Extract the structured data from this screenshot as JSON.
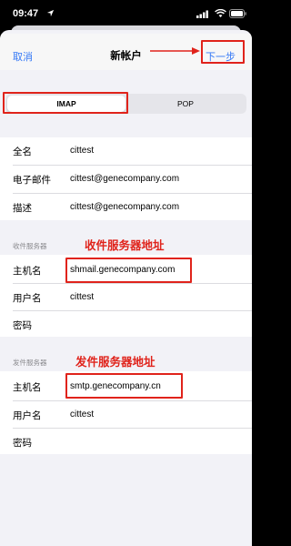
{
  "status_bar": {
    "time": "09:47"
  },
  "nav": {
    "cancel_label": "取消",
    "title": "新帐户",
    "next_label": "下一步"
  },
  "segment": {
    "options": [
      "IMAP",
      "POP"
    ],
    "selected": "IMAP"
  },
  "account": {
    "rows": [
      {
        "label": "全名",
        "value": "cittest"
      },
      {
        "label": "电子邮件",
        "value": "cittest@genecompany.com"
      },
      {
        "label": "描述",
        "value": "cittest@genecompany.com"
      }
    ]
  },
  "incoming": {
    "header": "收件服务器",
    "annotation": "收件服务器地址",
    "rows": [
      {
        "label": "主机名",
        "value": "shmail.genecompany.com"
      },
      {
        "label": "用户名",
        "value": "cittest"
      },
      {
        "label": "密码",
        "value": ""
      }
    ]
  },
  "outgoing": {
    "header": "发件服务器",
    "annotation": "发件服务器地址",
    "rows": [
      {
        "label": "主机名",
        "value": "smtp.genecompany.cn"
      },
      {
        "label": "用户名",
        "value": "cittest"
      },
      {
        "label": "密码",
        "value": ""
      }
    ]
  },
  "colors": {
    "accent": "#3478f6",
    "annotation": "#e0231b",
    "background": "#f2f2f7"
  }
}
